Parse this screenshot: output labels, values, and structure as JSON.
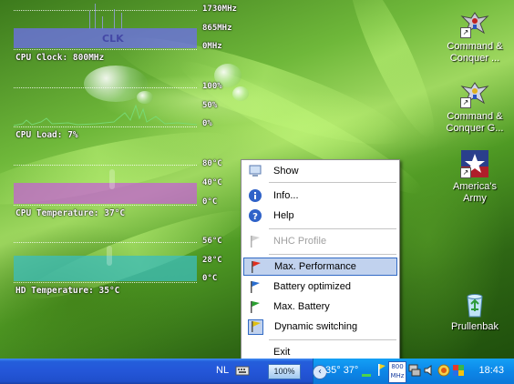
{
  "monitor": {
    "clock": {
      "scale_top": "1730MHz",
      "scale_mid": "865MHz",
      "scale_bot": "0MHz",
      "watermark": "CLK",
      "label": "CPU Clock: 800MHz"
    },
    "load": {
      "scale_top": "100%",
      "scale_mid": "50%",
      "scale_bot": "0%",
      "label": "CPU Load: 7%"
    },
    "cpu_temp": {
      "scale_top": "80°C",
      "scale_mid": "40°C",
      "scale_bot": "0°C",
      "label": "CPU Temperature: 37°C"
    },
    "hd_temp": {
      "scale_top": "56°C",
      "scale_mid": "28°C",
      "scale_bot": "0°C",
      "label": "HD Temperature: 35°C"
    }
  },
  "desktop_icons": [
    {
      "name": "Command & Conquer ...",
      "line1": "Command &",
      "line2": "Conquer ...",
      "icon": "eagle-icon"
    },
    {
      "name": "Command & Conquer G...",
      "line1": "Command &",
      "line2": "Conquer G...",
      "icon": "eagle-icon"
    },
    {
      "name": "America's Army",
      "line1": "America's",
      "line2": "Army",
      "icon": "star-flag-icon"
    },
    {
      "name": "Prullenbak",
      "line1": "Prullenbak",
      "line2": "",
      "icon": "recycle-bin-icon"
    }
  ],
  "context_menu": {
    "items": [
      {
        "label": "Show",
        "icon": "monitor-icon",
        "enabled": true
      },
      {
        "label": "Info...",
        "icon": "info-icon",
        "enabled": true
      },
      {
        "label": "Help",
        "icon": "help-icon",
        "enabled": true
      },
      {
        "label": "NHC Profile",
        "icon": "gray-flag-icon",
        "enabled": false
      },
      {
        "label": "Max. Performance",
        "icon": "red-flag-icon",
        "enabled": true,
        "highlighted": true
      },
      {
        "label": "Battery optimized",
        "icon": "blue-flag-icon",
        "enabled": true
      },
      {
        "label": "Max. Battery",
        "icon": "green-flag-icon",
        "enabled": true
      },
      {
        "label": "Dynamic switching",
        "icon": "yellow-flag-icon",
        "enabled": true,
        "checked": true
      },
      {
        "label": "Exit",
        "icon": "",
        "enabled": true
      }
    ]
  },
  "taskbar": {
    "language": "NL",
    "battery_percent": "100%",
    "temps": "35° 37°",
    "cpu_clock": "800",
    "cpu_unit": "MHz",
    "clock": "18:43"
  },
  "colors": {
    "highlight_bg": "#c1d2ee",
    "highlight_border": "#316ac5",
    "taskbar_blue": "#245edb",
    "tray_blue": "#0c87e8"
  }
}
